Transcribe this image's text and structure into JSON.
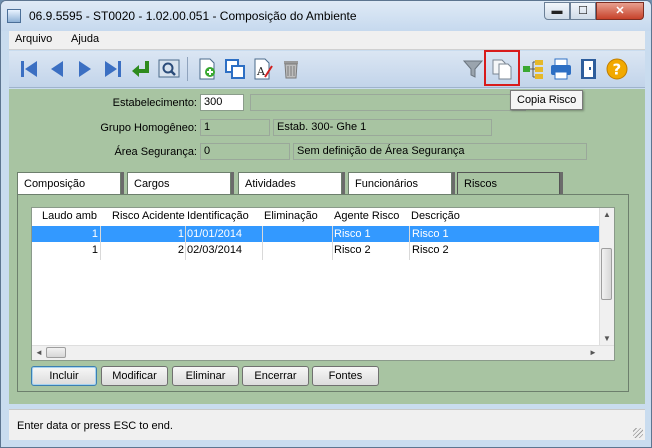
{
  "window": {
    "title": "06.9.5595 - ST0020 - 1.02.00.051 - Composição do Ambiente",
    "minimize_glyph": "▬",
    "maximize_glyph": "☐",
    "close_glyph": "✕"
  },
  "menu": {
    "items": [
      "Arquivo",
      "Ajuda"
    ]
  },
  "toolbar": {
    "icons": [
      "first-record-icon",
      "previous-record-icon",
      "next-record-icon",
      "last-record-icon",
      "go-to-icon",
      "search-icon",
      "add-icon",
      "copy-icon",
      "edit-icon",
      "delete-icon",
      "filter-icon",
      "copy-risk-icon",
      "hierarchy-icon",
      "print-icon",
      "exit-icon",
      "help-icon"
    ],
    "tooltip": "Copia Risco"
  },
  "form": {
    "estabelecimento_label": "Estabelecimento:",
    "estabelecimento_value": "300",
    "estabelecimento_desc": "",
    "grupo_label": "Grupo Homogêneo:",
    "grupo_value": "1",
    "grupo_desc": "Estab. 300- Ghe 1",
    "area_label": "Área Segurança:",
    "area_value": "0",
    "area_desc": "Sem definição de Área Segurança"
  },
  "tabs": [
    {
      "label": "Composição"
    },
    {
      "label": "Cargos"
    },
    {
      "label": "Atividades"
    },
    {
      "label": "Funcionários"
    },
    {
      "label": "Riscos"
    }
  ],
  "grid": {
    "columns": [
      "Laudo amb",
      "Risco Acidente",
      "Identificação",
      "Eliminação",
      "Agente Risco",
      "Descrição"
    ],
    "rows": [
      {
        "laudo": "1",
        "risco_acidente": "1",
        "identificacao": "01/01/2014",
        "eliminacao": "",
        "agente": "Risco 1",
        "descricao": "Risco 1"
      },
      {
        "laudo": "1",
        "risco_acidente": "2",
        "identificacao": "02/03/2014",
        "eliminacao": "",
        "agente": "Risco 2",
        "descricao": "Risco 2"
      }
    ],
    "selected_row": 0,
    "scroll_up_glyph": "▲",
    "scroll_down_glyph": "▼",
    "scroll_left_glyph": "◄",
    "scroll_right_glyph": "►"
  },
  "buttons": {
    "incluir": "Incluir",
    "modificar": "Modificar",
    "eliminar": "Eliminar",
    "encerrar": "Encerrar",
    "fontes": "Fontes"
  },
  "status": {
    "text": "Enter data or press ESC to end."
  },
  "colors": {
    "form_background": "#a8c4a2",
    "selection": "#3399ff",
    "highlight_box": "#d81b1b"
  }
}
